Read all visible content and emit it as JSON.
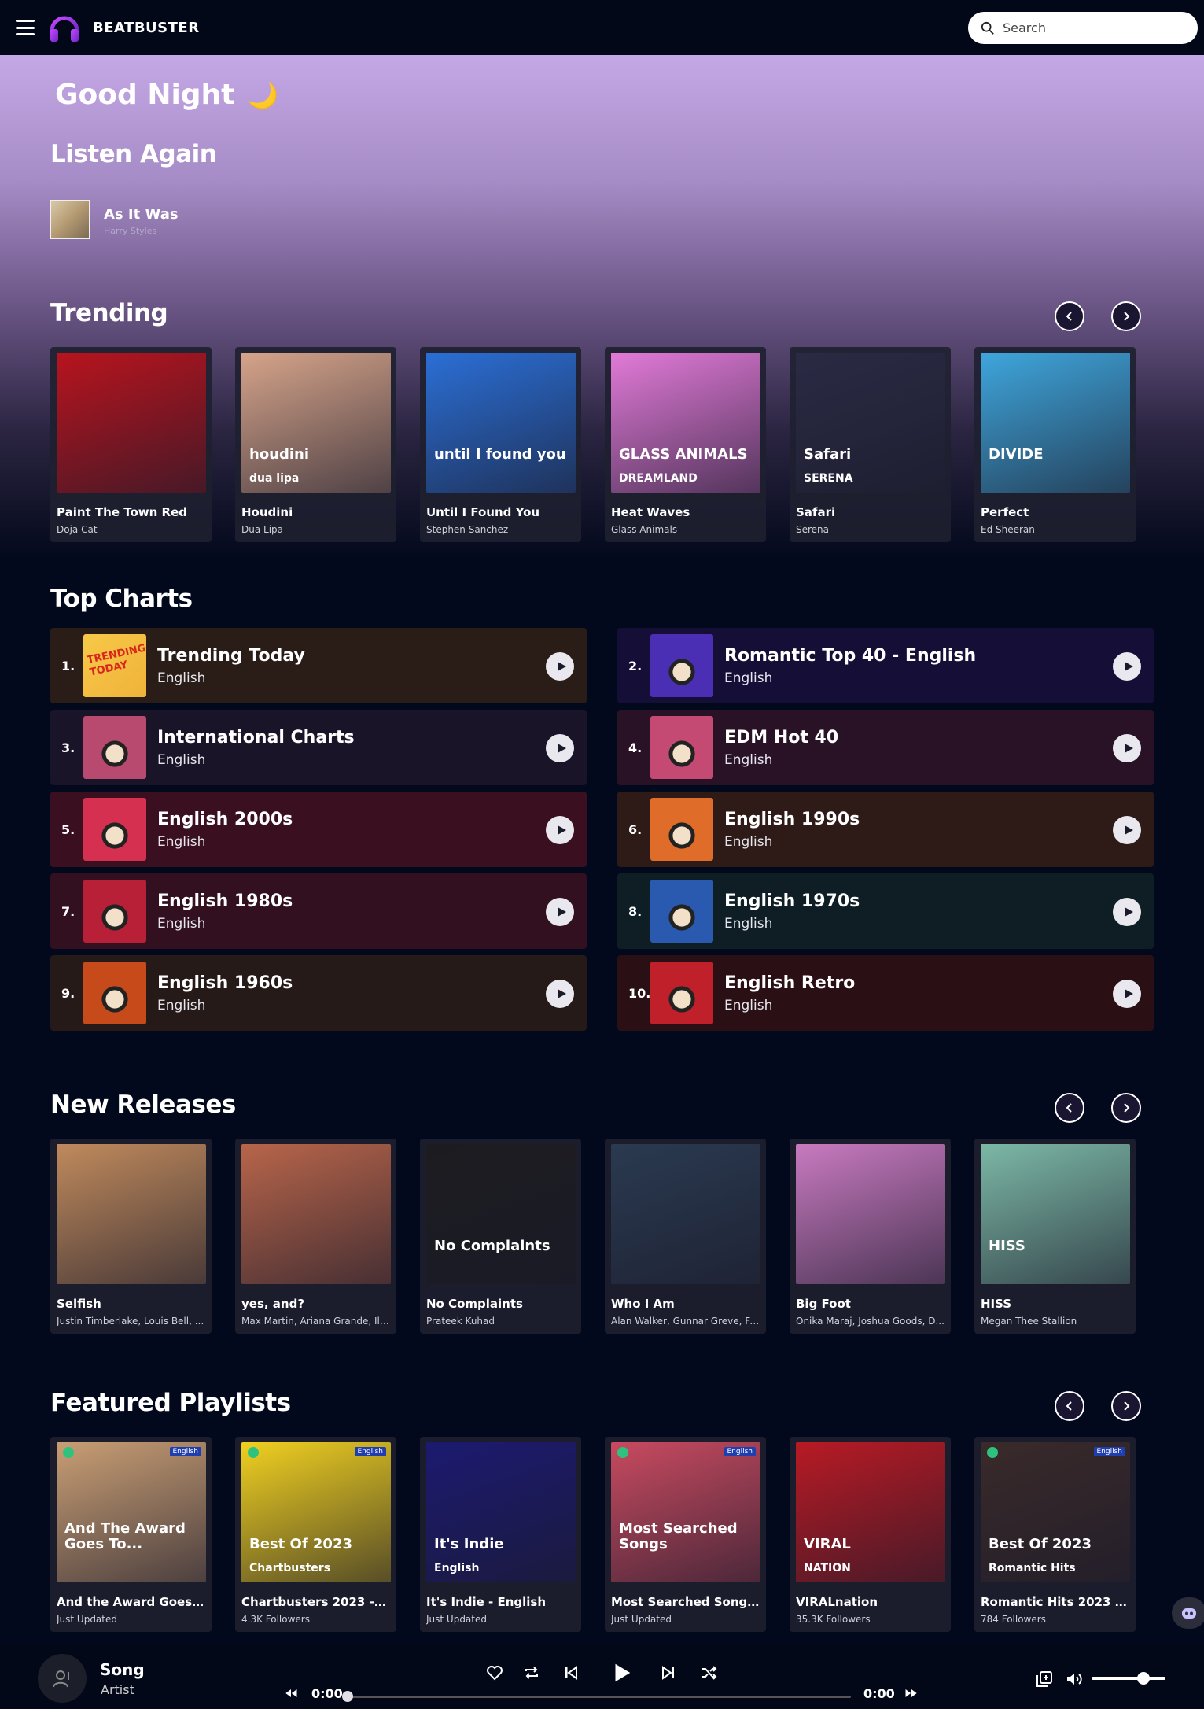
{
  "header": {
    "brand": "BEATBUSTER",
    "search_placeholder": "Search"
  },
  "greeting": {
    "text": "Good Night",
    "emoji": "🌙"
  },
  "listen_again": {
    "title": "Listen Again",
    "items": [
      {
        "title": "As It Was",
        "artist": "Harry Styles"
      }
    ]
  },
  "trending": {
    "title": "Trending",
    "items": [
      {
        "title": "Paint The Town Red",
        "artist": "Doja Cat",
        "color": "#b8141e"
      },
      {
        "title": "Houdini",
        "artist": "Dua Lipa",
        "color": "#d6a48a",
        "art_text": "houdini",
        "art_text2": "dua lipa"
      },
      {
        "title": "Until I Found You",
        "artist": "Stephen Sanchez",
        "color": "#2b6fd6",
        "art_text": "until I found you"
      },
      {
        "title": "Heat Waves",
        "artist": "Glass Animals",
        "color": "#e27ad8",
        "art_text": "GLASS ANIMALS",
        "art_text2": "DREAMLAND"
      },
      {
        "title": "Safari",
        "artist": "Serena",
        "color": "#2a2a44",
        "art_text": "Safari",
        "art_text2": "SERENA"
      },
      {
        "title": "Perfect",
        "artist": "Ed Sheeran",
        "color": "#3fa6dc",
        "art_text": "DIVIDE"
      }
    ]
  },
  "top_charts": {
    "title": "Top Charts",
    "items": [
      {
        "rank": "1.",
        "title": "Trending Today",
        "language": "English",
        "bg": "#2a1c16",
        "art_color": "#f0b23a",
        "art_text": "TRENDING TODAY"
      },
      {
        "rank": "2.",
        "title": "Romantic Top 40 - English",
        "language": "English",
        "bg": "#150f38",
        "art_color": "#4a2fb5"
      },
      {
        "rank": "3.",
        "title": "International Charts",
        "language": "English",
        "bg": "#1a1428",
        "art_color": "#b84a70"
      },
      {
        "rank": "4.",
        "title": "EDM Hot 40",
        "language": "English",
        "bg": "#2a1226",
        "art_color": "#c44a74"
      },
      {
        "rank": "5.",
        "title": "English 2000s",
        "language": "English",
        "bg": "#3a1020",
        "art_color": "#d63050"
      },
      {
        "rank": "6.",
        "title": "English 1990s",
        "language": "English",
        "bg": "#2e1a16",
        "art_color": "#e06c2a"
      },
      {
        "rank": "7.",
        "title": "English 1980s",
        "language": "English",
        "bg": "#321020",
        "art_color": "#b82038"
      },
      {
        "rank": "8.",
        "title": "English 1970s",
        "language": "English",
        "bg": "#0f1e24",
        "art_color": "#2a5ab0"
      },
      {
        "rank": "9.",
        "title": "English 1960s",
        "language": "English",
        "bg": "#261a18",
        "art_color": "#c64a1a"
      },
      {
        "rank": "10.",
        "title": "English Retro",
        "language": "English",
        "bg": "#2a1014",
        "art_color": "#c0202a"
      }
    ]
  },
  "new_releases": {
    "title": "New Releases",
    "items": [
      {
        "title": "Selfish",
        "artist": "Justin Timberlake, Louis Bell, ...",
        "color": "#c08a5c"
      },
      {
        "title": "yes, and?",
        "artist": "Max Martin, Ariana Grande, Ily...",
        "color": "#b8654a"
      },
      {
        "title": "No Complaints",
        "artist": "Prateek Kuhad",
        "color": "#1c1c20",
        "art_text": "No Complaints"
      },
      {
        "title": "Who I Am",
        "artist": "Alan Walker, Gunnar Greve, Fr...",
        "color": "#2a3a50"
      },
      {
        "title": "Big Foot",
        "artist": "Onika Maraj, Joshua Goods, D...",
        "color": "#c87ac0"
      },
      {
        "title": "HISS",
        "artist": "Megan Thee Stallion",
        "color": "#7cb8a6",
        "art_text": "HISS"
      }
    ]
  },
  "featured_playlists": {
    "title": "Featured Playlists",
    "items": [
      {
        "title": "And the Award Goes To",
        "followers": "Just Updated",
        "color": "#c99e74",
        "art_text": "And The Award Goes To...",
        "badge": "English"
      },
      {
        "title": "Chartbusters 2023 - Engli...",
        "followers": "4.3K Followers",
        "color": "#f0d020",
        "art_text": "Best Of 2023",
        "art_text2": "Chartbusters",
        "badge": "English"
      },
      {
        "title": "It's Indie - English",
        "followers": "Just Updated",
        "color": "#1c1a70",
        "art_text": "It's Indie",
        "art_text2": "English"
      },
      {
        "title": "Most Searched Songs - E...",
        "followers": "Just Updated",
        "color": "#c84a60",
        "art_text": "Most Searched Songs",
        "badge": "English"
      },
      {
        "title": "VIRALnation",
        "followers": "35.3K Followers",
        "color": "#b81a24",
        "art_text": "VIRAL",
        "art_text2": "NATION"
      },
      {
        "title": "Romantic Hits 2023 - Eng...",
        "followers": "784 Followers",
        "color": "#3a2a2a",
        "art_text": "Best Of 2023",
        "art_text2": "Romantic Hits",
        "badge": "English"
      }
    ]
  },
  "player": {
    "song": "Song",
    "artist": "Artist",
    "current_time": "0:00",
    "total_time": "0:00",
    "progress": 0,
    "volume": 0.7
  }
}
